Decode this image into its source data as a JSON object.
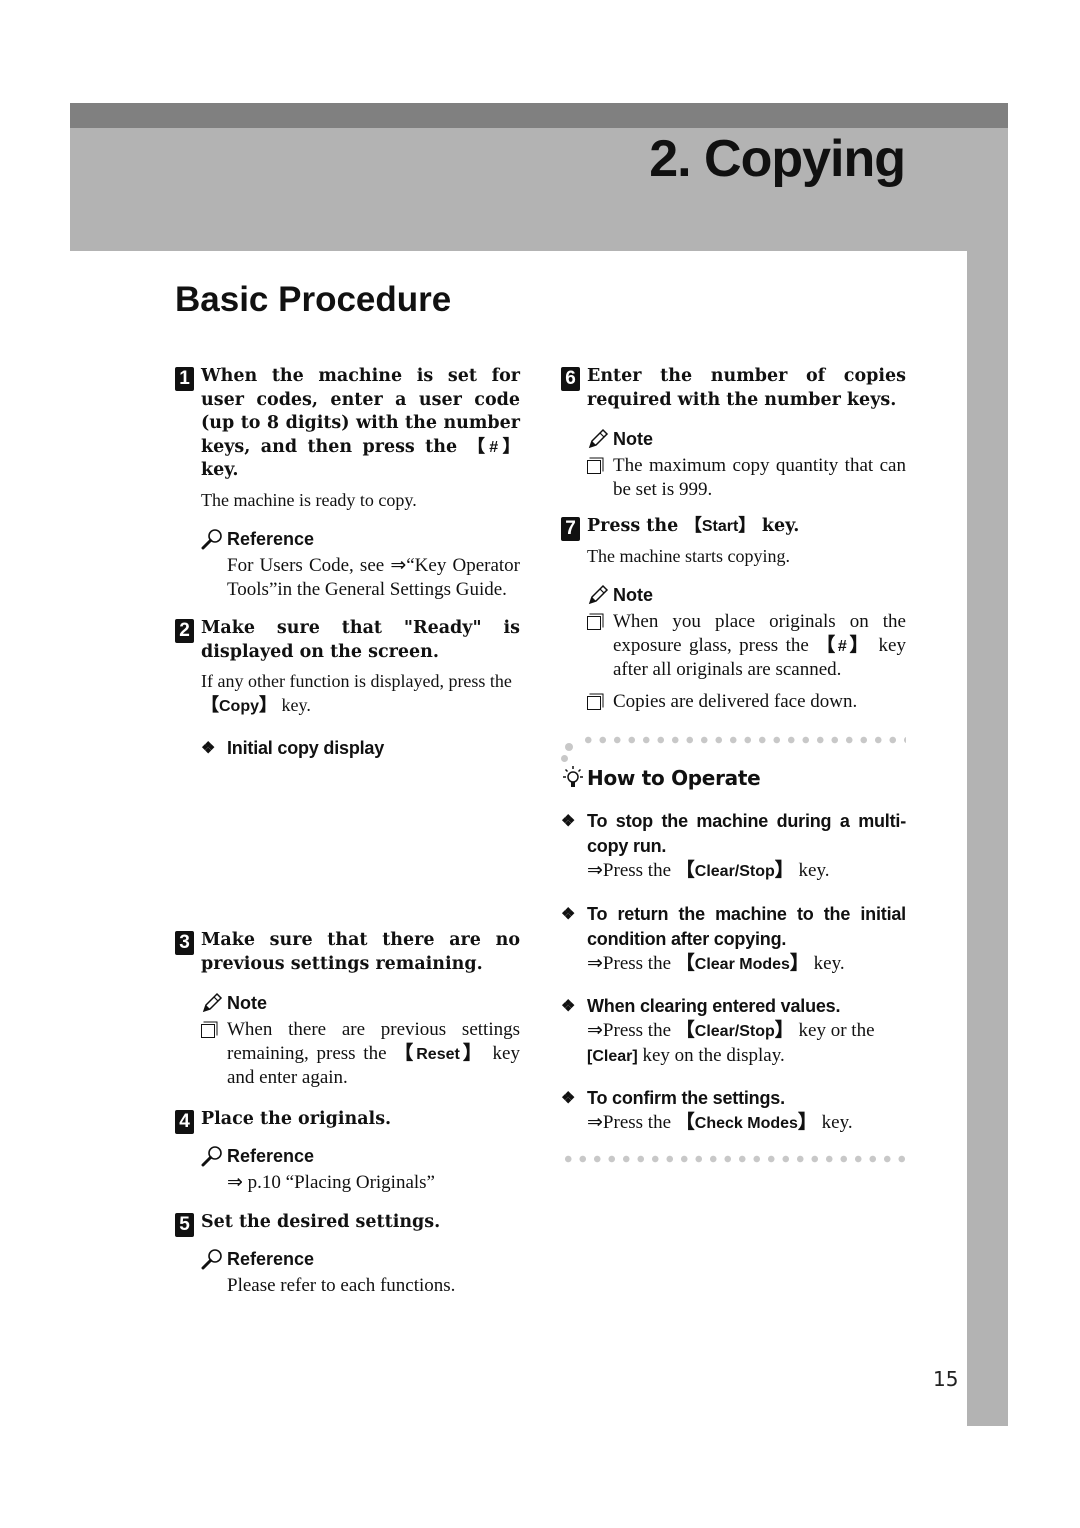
{
  "chapter": {
    "title": "2. Copying"
  },
  "section": {
    "title": "Basic Procedure"
  },
  "steps": [
    {
      "number": "1",
      "title_parts": [
        "When the machine is set for user codes, enter a user code (up to 8 digits) with the number keys, and then press the ",
        "#",
        " key."
      ],
      "body": "The machine is ready to copy.",
      "reference": {
        "label": "Reference",
        "text": "For Users Code, see ⇒“Key Operator Tools”in the General Settings Guide."
      }
    },
    {
      "number": "2",
      "title": "Make sure that \"Ready\" is displayed on the screen.",
      "body_parts": [
        "If any other function is displayed, press the ",
        "Copy",
        " key."
      ],
      "subheading": "Initial copy display"
    },
    {
      "number": "3",
      "title": "Make sure that there are no previous settings remaining.",
      "note": {
        "label": "Note",
        "items": [
          {
            "parts": [
              "When there are previous settings remaining, press the ",
              "Reset",
              " key and enter again."
            ]
          }
        ]
      }
    },
    {
      "number": "4",
      "title": "Place the originals.",
      "reference": {
        "label": "Reference",
        "text": "⇒ p.10 “Placing Originals”"
      }
    },
    {
      "number": "5",
      "title": "Set the desired settings.",
      "reference": {
        "label": "Reference",
        "text": "Please refer to each functions."
      }
    },
    {
      "number": "6",
      "title": "Enter the number of copies required with the number keys.",
      "note": {
        "label": "Note",
        "items": [
          {
            "text": "The maximum copy quantity that can be set is 999."
          }
        ]
      }
    },
    {
      "number": "7",
      "title_parts": [
        "Press the ",
        "Start",
        " key."
      ],
      "body": "The machine starts copying.",
      "note": {
        "label": "Note",
        "items": [
          {
            "parts": [
              "When you place originals on the exposure glass, press the ",
              "#",
              " key after all originals are scanned."
            ]
          },
          {
            "text": "Copies are delivered face down."
          }
        ]
      }
    }
  ],
  "how_to_operate": {
    "title": "How to Operate",
    "items": [
      {
        "heading": "To stop the machine during a multi-copy run.",
        "action_parts": [
          "⇒Press the ",
          "Clear/Stop",
          " key."
        ]
      },
      {
        "heading": "To return the machine to the initial condition after copying.",
        "action_parts": [
          "⇒Press the ",
          "Clear Modes",
          " key."
        ]
      },
      {
        "heading": "When clearing entered values.",
        "action_parts": [
          "⇒Press the ",
          "Clear/Stop",
          " key or the ",
          "[Clear]",
          " key on the display."
        ]
      },
      {
        "heading": "To confirm the settings.",
        "action_parts": [
          "⇒Press the ",
          "Check Modes",
          " key."
        ]
      }
    ]
  },
  "page_number": "15",
  "icons": {
    "reference": "magnifier-icon",
    "note": "pencil-icon",
    "how_to_operate": "lightbulb-icon",
    "bullet": "diamond-bullet",
    "checkbox": "checkbox-icon"
  },
  "colors": {
    "header_band": "#b3b3b3",
    "top_bar": "#808080",
    "dots": "#c8c8c8"
  }
}
